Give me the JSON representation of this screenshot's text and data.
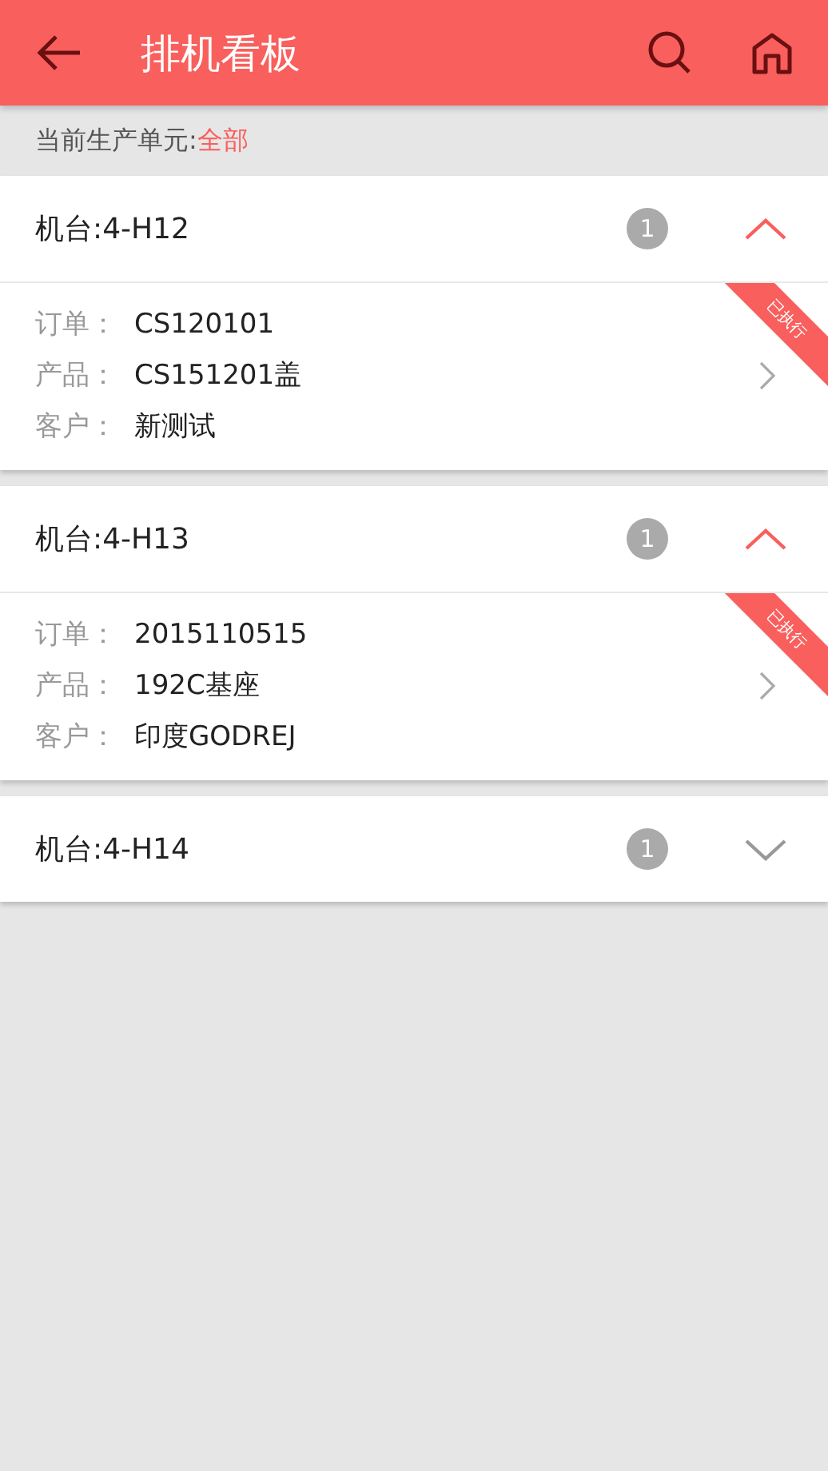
{
  "app_bar": {
    "title": "排机看板"
  },
  "filter": {
    "label": "当前生产单元:",
    "value": "全部"
  },
  "machines": [
    {
      "title": "机台:4-H12",
      "count": "1",
      "expanded": true,
      "order": {
        "ribbon": "已执行",
        "fields": [
          {
            "label": "订单：",
            "value": "CS120101"
          },
          {
            "label": "产品：",
            "value": "CS151201盖"
          },
          {
            "label": "客户：",
            "value": "新测试"
          }
        ]
      }
    },
    {
      "title": "机台:4-H13",
      "count": "1",
      "expanded": true,
      "order": {
        "ribbon": "已执行",
        "fields": [
          {
            "label": "订单：",
            "value": "2015110515"
          },
          {
            "label": "产品：",
            "value": "192C基座"
          },
          {
            "label": "客户：",
            "value": "印度GODREJ"
          }
        ]
      }
    },
    {
      "title": "机台:4-H14",
      "count": "1",
      "expanded": false
    }
  ]
}
